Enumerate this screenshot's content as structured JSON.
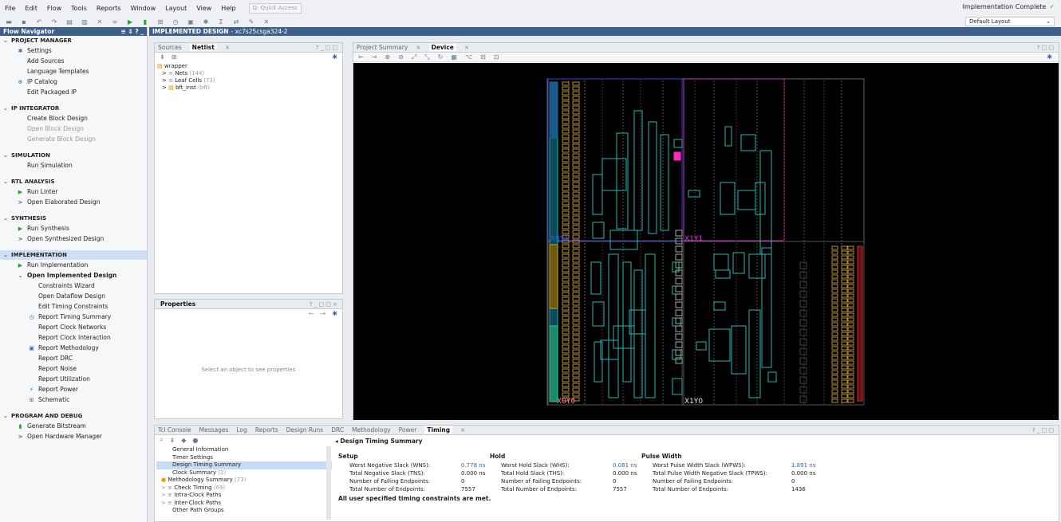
{
  "menubar": {
    "items": [
      "File",
      "Edit",
      "Flow",
      "Tools",
      "Reports",
      "Window",
      "Layout",
      "View",
      "Help"
    ],
    "quick_access": "Q: Quick Access",
    "status": "Implementation Complete",
    "layout": "Default Layout"
  },
  "flow_nav": {
    "title": "Flow Navigator",
    "controls": "≡ ⇕ ? _",
    "sections": [
      {
        "title": "PROJECT MANAGER",
        "items": [
          {
            "label": "Settings",
            "icon": "gear-icon",
            "level": 1
          },
          {
            "label": "Add Sources",
            "level": 2
          },
          {
            "label": "Language Templates",
            "level": 2
          },
          {
            "label": "IP Catalog",
            "icon": "ip-icon",
            "level": 1
          },
          {
            "label": "Edit Packaged IP",
            "level": 2
          }
        ]
      },
      {
        "title": "IP INTEGRATOR",
        "items": [
          {
            "label": "Create Block Design",
            "level": 2
          },
          {
            "label": "Open Block Design",
            "level": 2,
            "disabled": true
          },
          {
            "label": "Generate Block Design",
            "level": 2,
            "disabled": true
          }
        ]
      },
      {
        "title": "SIMULATION",
        "items": [
          {
            "label": "Run Simulation",
            "level": 2
          }
        ]
      },
      {
        "title": "RTL ANALYSIS",
        "items": [
          {
            "label": "Run Linter",
            "icon": "play-icon",
            "level": 1
          },
          {
            "label": "Open Elaborated Design",
            "icon": "chevron-right-icon",
            "level": 1
          }
        ]
      },
      {
        "title": "SYNTHESIS",
        "items": [
          {
            "label": "Run Synthesis",
            "icon": "play-icon",
            "level": 1
          },
          {
            "label": "Open Synthesized Design",
            "icon": "chevron-right-icon",
            "level": 1
          }
        ]
      },
      {
        "title": "IMPLEMENTATION",
        "active": true,
        "items": [
          {
            "label": "Run Implementation",
            "icon": "play-icon",
            "level": 1
          },
          {
            "label": "Open Implemented Design",
            "icon": "chevron-down-icon",
            "level": 1,
            "bold": true
          },
          {
            "label": "Constraints Wizard",
            "level": 3
          },
          {
            "label": "Open Dataflow Design",
            "level": 3
          },
          {
            "label": "Edit Timing Constraints",
            "level": 3
          },
          {
            "label": "Report Timing Summary",
            "icon": "clock-icon",
            "level": 2
          },
          {
            "label": "Report Clock Networks",
            "level": 3
          },
          {
            "label": "Report Clock Interaction",
            "level": 3
          },
          {
            "label": "Report Methodology",
            "icon": "report-icon",
            "level": 2
          },
          {
            "label": "Report DRC",
            "level": 3
          },
          {
            "label": "Report Noise",
            "level": 3
          },
          {
            "label": "Report Utilization",
            "level": 3
          },
          {
            "label": "Report Power",
            "icon": "power-icon",
            "level": 2
          },
          {
            "label": "Schematic",
            "icon": "schematic-icon",
            "level": 2
          }
        ]
      },
      {
        "title": "PROGRAM AND DEBUG",
        "items": [
          {
            "label": "Generate Bitstream",
            "icon": "bitstream-icon",
            "level": 1
          },
          {
            "label": "Open Hardware Manager",
            "icon": "chevron-right-icon",
            "level": 1
          }
        ]
      }
    ]
  },
  "design": {
    "title": "IMPLEMENTED DESIGN",
    "part": "- xc7s25csga324-2"
  },
  "netlist": {
    "tabs": [
      "Sources",
      "Netlist"
    ],
    "active_tab": "Netlist",
    "controls": "? _ □ □",
    "root": "wrapper",
    "children": [
      {
        "label": "Nets",
        "count": "(144)"
      },
      {
        "label": "Leaf Cells",
        "count": "(73)"
      },
      {
        "label": "bft_inst",
        "count": "(bft)"
      }
    ]
  },
  "properties": {
    "title": "Properties",
    "controls": "? _ □ □ ×",
    "placeholder": "Select an object to see properties"
  },
  "device": {
    "tabs": [
      "Project Summary",
      "Device"
    ],
    "active_tab": "Device",
    "controls": "? □ □",
    "regions": [
      "X0Y1",
      "X1Y1",
      "X0Y0",
      "X1Y0"
    ]
  },
  "bottom": {
    "tabs": [
      "Tcl Console",
      "Messages",
      "Log",
      "Reports",
      "Design Runs",
      "DRC",
      "Methodology",
      "Power",
      "Timing"
    ],
    "active_tab": "Timing",
    "controls": "? _ □ □",
    "tree": [
      {
        "label": "General Information"
      },
      {
        "label": "Timer Settings"
      },
      {
        "label": "Design Timing Summary",
        "selected": true
      },
      {
        "label": "Clock Summary",
        "count": "(2)"
      },
      {
        "label": "Methodology Summary",
        "count": "(73)",
        "icon": "warning-icon"
      },
      {
        "label": "Check Timing",
        "count": "(69)",
        "icon": "chevron-right-icon"
      },
      {
        "label": "Intra-Clock Paths",
        "icon": "chevron-right-icon"
      },
      {
        "label": "Inter-Clock Paths",
        "icon": "chevron-right-icon"
      },
      {
        "label": "Other Path Groups"
      }
    ],
    "summary_title": "Design Timing Summary",
    "setup": {
      "title": "Setup",
      "rows": [
        {
          "k": "Worst Negative Slack (WNS):",
          "v": "0.778 ns",
          "link": true
        },
        {
          "k": "Total Negative Slack (TNS):",
          "v": "0.000 ns"
        },
        {
          "k": "Number of Failing Endpoints:",
          "v": "0"
        },
        {
          "k": "Total Number of Endpoints:",
          "v": "7557"
        }
      ]
    },
    "hold": {
      "title": "Hold",
      "rows": [
        {
          "k": "Worst Hold Slack (WHS):",
          "v": "0.081 ns",
          "link": true
        },
        {
          "k": "Total Hold Slack (THS):",
          "v": "0.000 ns"
        },
        {
          "k": "Number of Failing Endpoints:",
          "v": "0"
        },
        {
          "k": "Total Number of Endpoints:",
          "v": "7557"
        }
      ]
    },
    "pulse": {
      "title": "Pulse Width",
      "rows": [
        {
          "k": "Worst Pulse Width Slack (WPWS):",
          "v": "1.891 ns",
          "link": true
        },
        {
          "k": "Total Pulse Width Negative Slack (TPWS):",
          "v": "0.000 ns"
        },
        {
          "k": "Number of Failing Endpoints:",
          "v": "0"
        },
        {
          "k": "Total Number of Endpoints:",
          "v": "1436"
        }
      ]
    },
    "met_message": "All user specified timing constraints are met."
  },
  "colors": {
    "accent": "#3f5f88",
    "slack": "#2a62c8",
    "cell": "#2bb5b5",
    "green": "#2aa02a"
  }
}
